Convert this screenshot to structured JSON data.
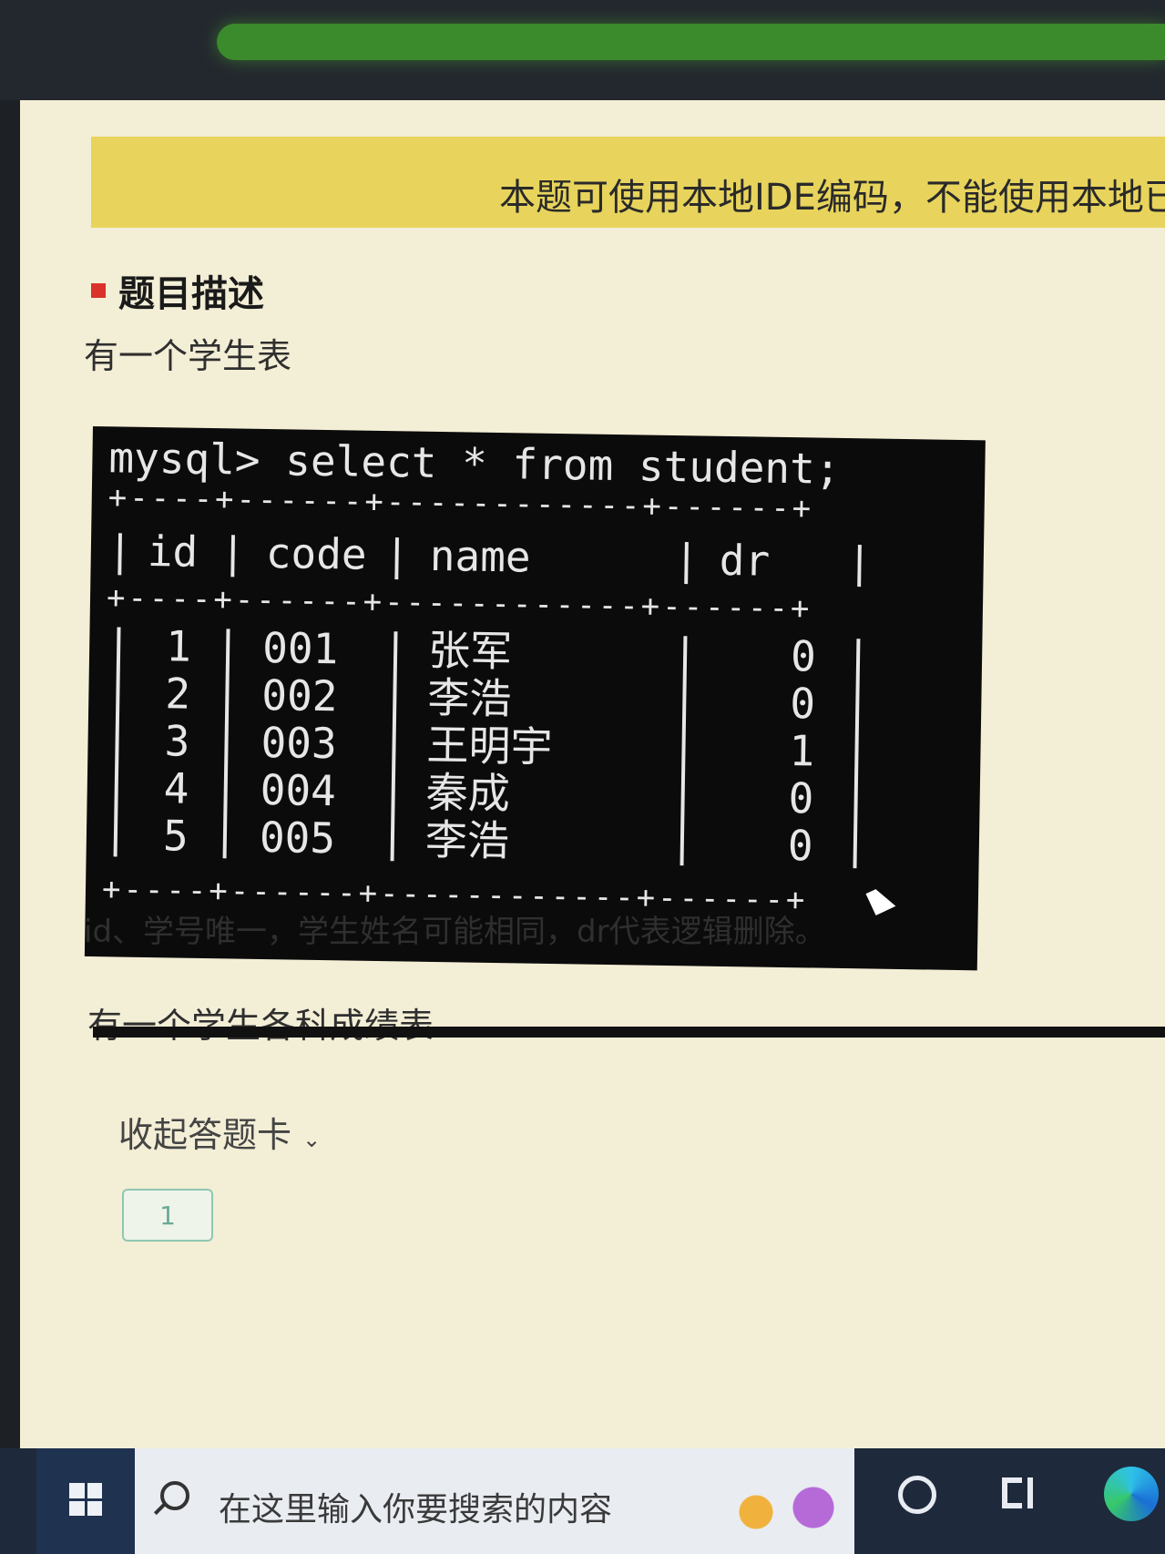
{
  "notice": "本题可使用本地IDE编码，不能使用本地已有",
  "section_title": "题目描述",
  "intro": "有一个学生表",
  "terminal": {
    "command": "mysql> select * from student;",
    "separator": "+----+------+------------+------+",
    "columns": [
      "id",
      "code",
      "name",
      "dr"
    ],
    "rows": [
      {
        "id": "1",
        "code": "001",
        "name": "张军",
        "dr": "0"
      },
      {
        "id": "2",
        "code": "002",
        "name": "李浩",
        "dr": "0"
      },
      {
        "id": "3",
        "code": "003",
        "name": "王明宇",
        "dr": "1"
      },
      {
        "id": "4",
        "code": "004",
        "name": "秦成",
        "dr": "0"
      },
      {
        "id": "5",
        "code": "005",
        "name": "李浩",
        "dr": "0"
      }
    ]
  },
  "description": "id、学号唯一，学生姓名可能相同，dr代表逻辑删除。",
  "intro2": "有一个学生各科成绩表",
  "answer_card_toggle": "收起答题卡",
  "question_number": "1",
  "taskbar": {
    "search_placeholder": "在这里输入你要搜索的内容"
  }
}
